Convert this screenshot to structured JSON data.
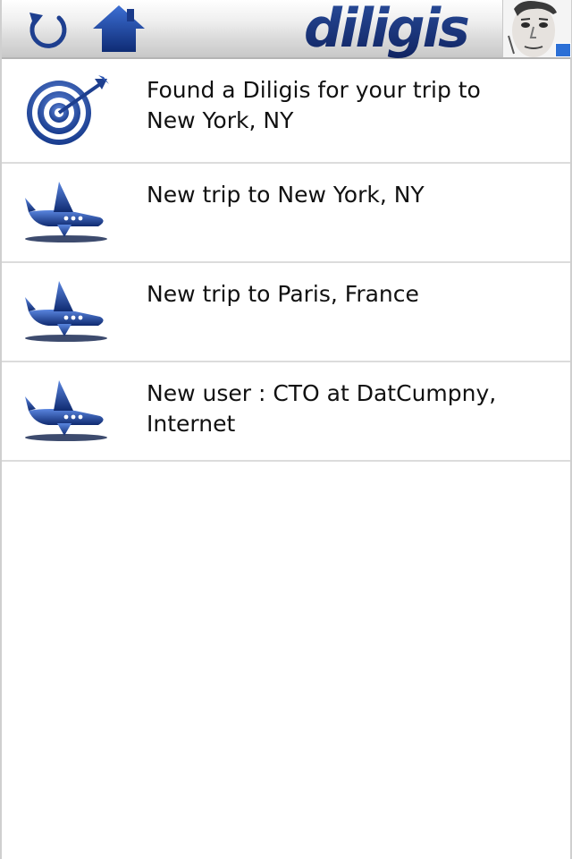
{
  "header": {
    "logo_text": "diligis",
    "refresh_icon": "refresh-icon",
    "home_icon": "home-icon",
    "avatar_icon": "user-avatar",
    "accent_color": "#1a3a8a"
  },
  "feed": {
    "items": [
      {
        "icon": "target-icon",
        "text": "Found a Diligis for your trip to New York, NY"
      },
      {
        "icon": "airplane-icon",
        "text": "New trip to New York, NY"
      },
      {
        "icon": "airplane-icon",
        "text": "New trip to Paris, France"
      },
      {
        "icon": "airplane-icon",
        "text": "New user : CTO at DatCumpny, Internet"
      }
    ]
  }
}
